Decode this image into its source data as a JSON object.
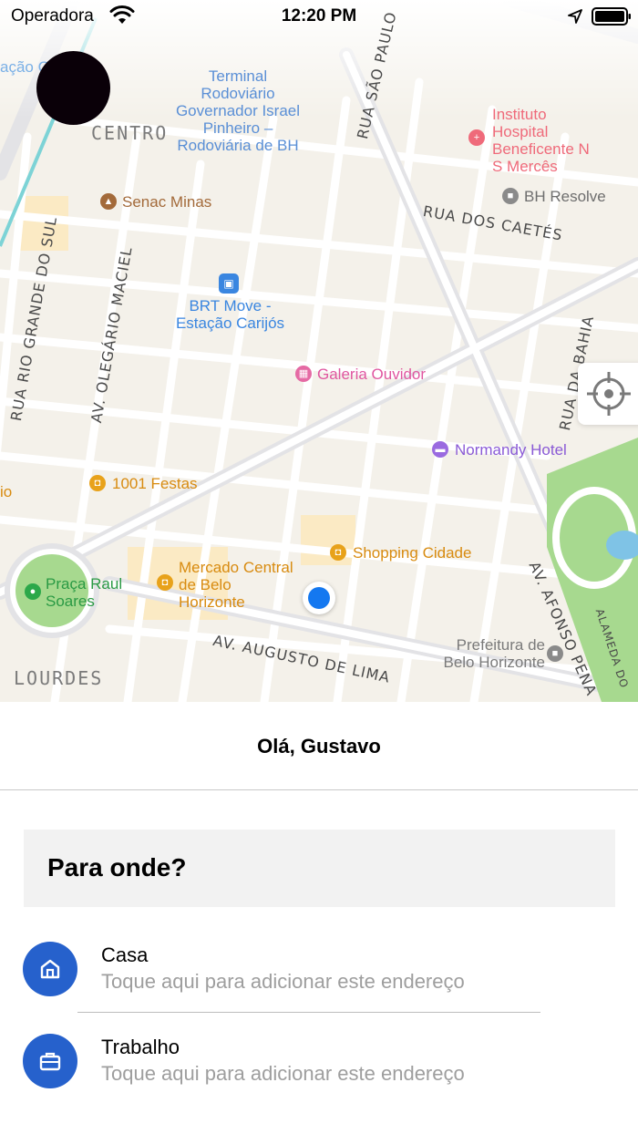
{
  "status_bar": {
    "carrier": "Operadora",
    "time": "12:20 PM"
  },
  "map": {
    "districts": {
      "centro": "CENTRO",
      "lourdes": "LOURDES"
    },
    "streets": {
      "rua_sao_paulo": "RUA SÃO PAULO",
      "rua_dos_caetes": "RUA DOS CAETÉS",
      "rua_rio_grande_do_sul": "RUA RIO GRANDE DO SUL",
      "av_olegario_maciel": "AV. OLEGÁRIO MACIEL",
      "rua_da_bahia": "RUA DA BAHIA",
      "av_augusto_de_lima": "AV. AUGUSTO DE LIMA",
      "av_afonso_pena": "AV. AFONSO PENA",
      "alameda": "ALAMEDA DO"
    },
    "pois": {
      "terminal": "Terminal Rodoviário Governador Israel Pinheiro – Rodoviária de BH",
      "hospital": "Instituto Hospital Beneficente N S Mercês",
      "senac": "Senac Minas",
      "bh_resolve": "BH Resolve",
      "brt": "BRT Move - Estação Carijós",
      "galeria": "Galeria Ouvidor",
      "normandy": "Normandy Hotel",
      "festas": "1001 Festas",
      "mercado": "Mercado Central de Belo Horizonte",
      "shopping": "Shopping Cidade",
      "praca": "Praça Raul Soares",
      "prefeitura": "Prefeitura de Belo Horizonte",
      "left_cut": "io",
      "top_cut": "ação Ce"
    },
    "colors": {
      "background": "#f4f1ea",
      "road": "#ffffff",
      "park": "#a7d98f",
      "user_location": "#1478f0"
    }
  },
  "greeting": "Olá, Gustavo",
  "search": {
    "label": "Para onde?"
  },
  "places": [
    {
      "title": "Casa",
      "subtitle": "Toque aqui para adicionar este endereço",
      "icon": "home-icon"
    },
    {
      "title": "Trabalho",
      "subtitle": "Toque aqui para adicionar este endereço",
      "icon": "briefcase-icon"
    }
  ],
  "accent_color": "#2661cc"
}
